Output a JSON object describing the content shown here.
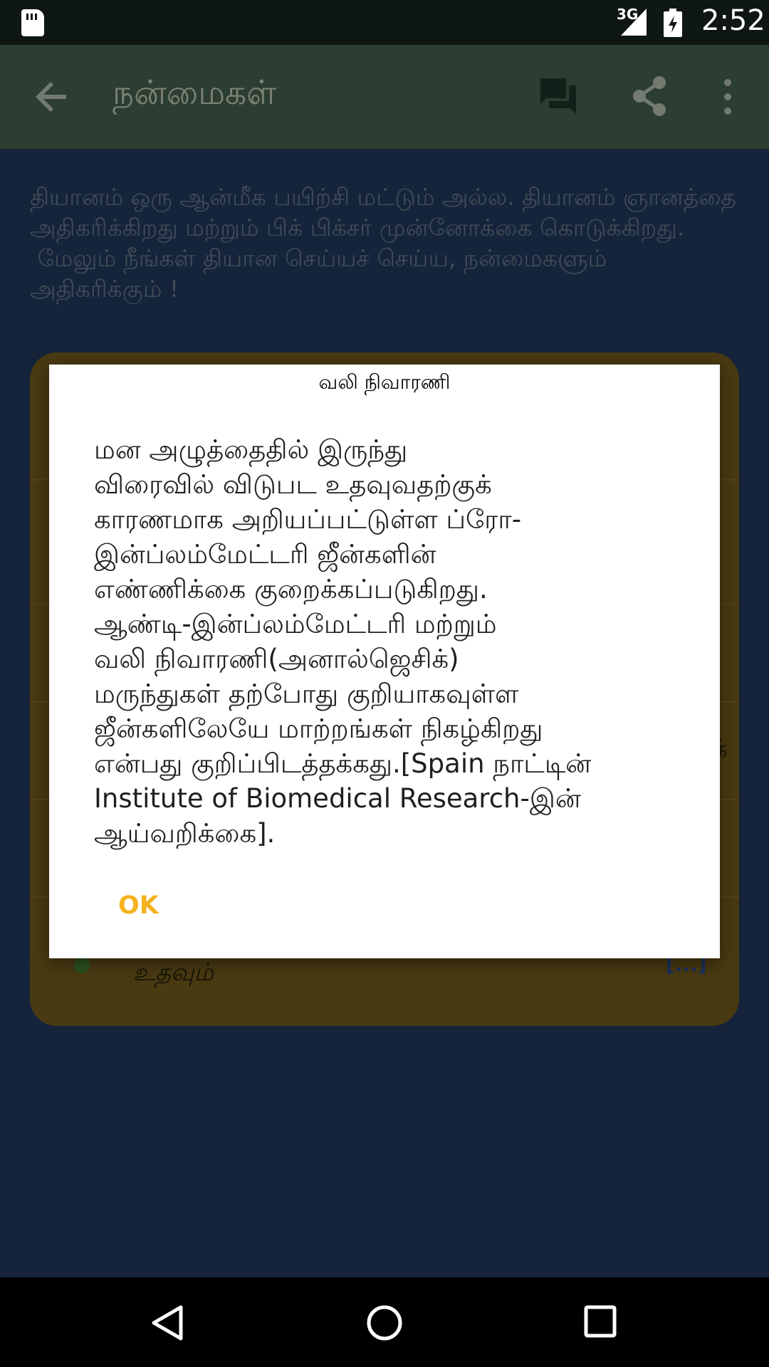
{
  "status_bar": {
    "network": "3G",
    "time": "2:52",
    "icons": [
      "sd-card-icon",
      "signal-icon",
      "battery-icon"
    ]
  },
  "toolbar": {
    "title": "நன்மைகள்",
    "icons": [
      "back-arrow-icon",
      "comment-icon",
      "share-icon",
      "more-vert-icon"
    ]
  },
  "main": {
    "intro_text": "தியானம் ஒரு ஆன்மீக பயிற்சி மட்டும் அல்ல. தியானம் ஞானத்தை அதிகரிக்கிறது மற்றும் பிக் பிக்சர் முன்னோக்கை கொடுக்கிறது.\n மேலும் நீங்கள் தியான செய்யச் செய்ய, நன்மைகளும் அதிகரிக்கும் !",
    "card": {
      "visible_text": "உதவும்",
      "more_link": "[...]",
      "partial_char": "க்"
    }
  },
  "dialog": {
    "title": "வலி நிவாரணி",
    "message": "மன அழுத்தைதில் இருந்து\nவிரைவில் விடுபட உதவுவதற்குக்\nகாரணமாக அறியப்பட்டுள்ள ப்ரோ-\nஇன்ப்லம்மேட்டரி ஜீன்களின்\nஎண்ணிக்கை குறைக்கப்படுகிறது.\nஆண்டி-இன்ப்லம்மேட்டரி மற்றும்\nவலி நிவாரணி(அனால்ஜெசிக்)\nமருந்துகள் தற்போது குறியாகவுள்ள\nஜீன்களிலேயே மாற்றங்கள் நிகழ்கிறது\nஎன்பது குறிப்பிடத்தக்கது.[Spain நாட்டின்\nInstitute of Biomedical Research-இன்\nஆய்வறிக்கை].",
    "ok_label": "OK"
  },
  "colors": {
    "accent": "#f4b31e",
    "toolbar": "#2c3d31",
    "background": "#15243a",
    "card": "#4a3a12"
  },
  "nav_bar": {
    "icons": [
      "nav-back-icon",
      "nav-home-icon",
      "nav-recents-icon"
    ]
  }
}
